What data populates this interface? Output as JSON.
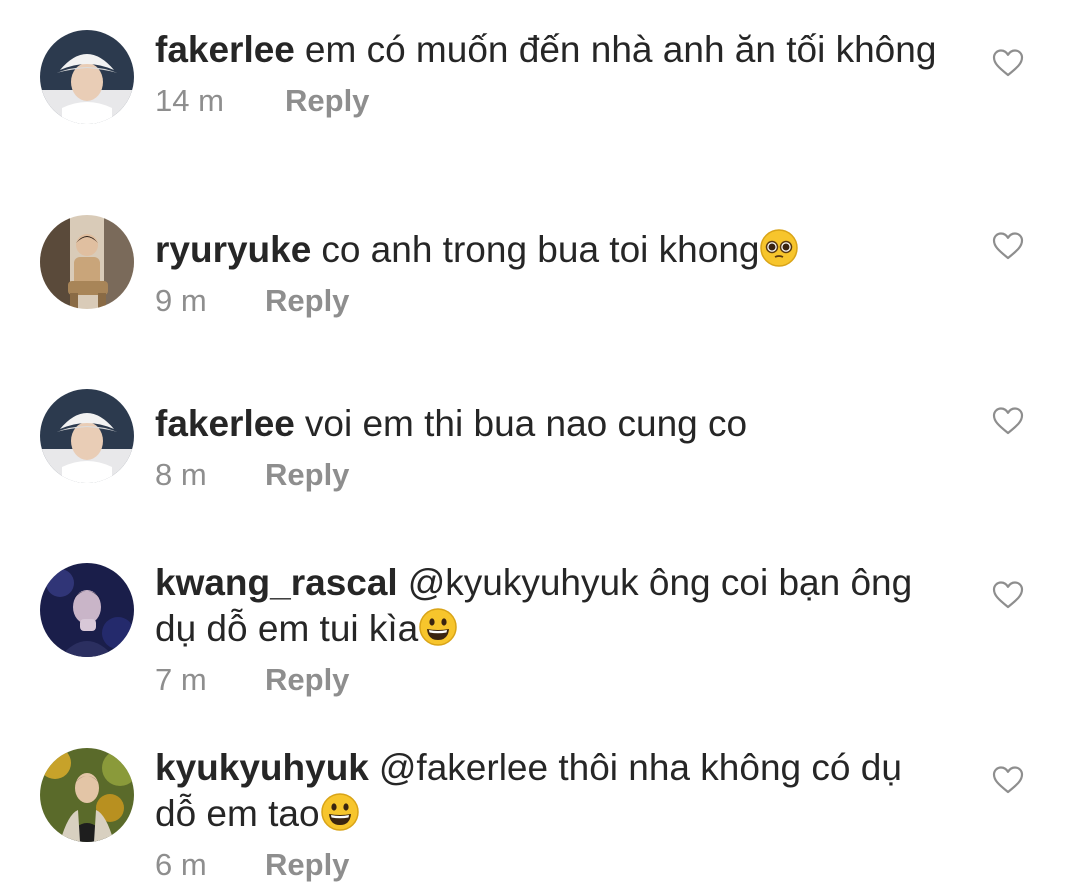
{
  "comments": [
    {
      "username": "fakerlee",
      "text": "em có muốn đến nhà anh ăn tối không",
      "emoji": "",
      "time": "14 m",
      "reply_label": "Reply",
      "avatar_icon": "user-avatar-white-bucket-hat"
    },
    {
      "username": "ryuryuke",
      "text": "co anh trong bua toi khong",
      "emoji": "pleading-face",
      "time": "9 m",
      "reply_label": "Reply",
      "avatar_icon": "user-avatar-seated-person"
    },
    {
      "username": "fakerlee",
      "text": "voi em thi bua nao cung co",
      "emoji": "",
      "time": "8 m",
      "reply_label": "Reply",
      "avatar_icon": "user-avatar-white-bucket-hat"
    },
    {
      "username": "kwang_rascal",
      "text": "@kyukyuhyuk ông coi bạn ông dụ dỗ em tui kìa",
      "emoji": "grinning-face",
      "time": "7 m",
      "reply_label": "Reply",
      "avatar_icon": "user-avatar-dark-stage"
    },
    {
      "username": "kyukyuhyuk",
      "text": "@fakerlee thôi nha không có dụ dỗ em tao",
      "emoji": "grinning-face",
      "time": "6 m",
      "reply_label": "Reply",
      "avatar_icon": "user-avatar-outdoor-trees"
    }
  ],
  "colors": {
    "text": "#262626",
    "meta": "#8e8e8e",
    "heart_outline": "#8e8e8e",
    "emoji_yellow": "#f7c52c"
  },
  "like_icon": "heart-outline-icon"
}
